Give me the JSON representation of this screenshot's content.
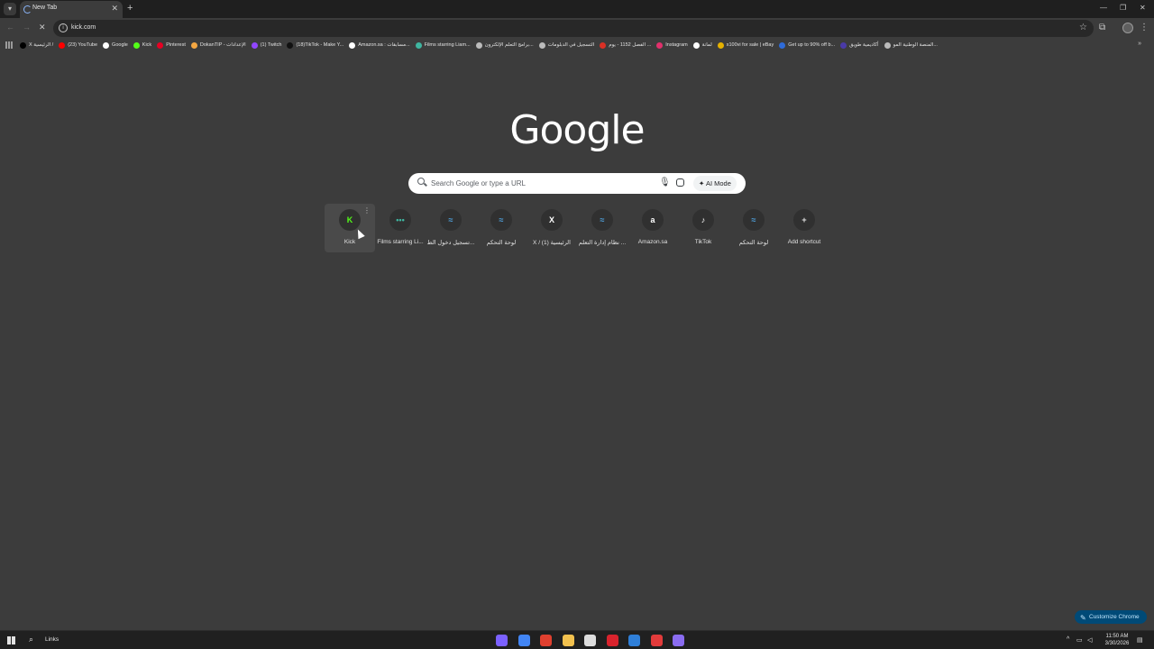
{
  "tab": {
    "title": "New Tab"
  },
  "omnibox": {
    "url": "kick.com"
  },
  "bookmarks": [
    {
      "label": "X الرئيسية /",
      "color": "#000000"
    },
    {
      "label": "(23) YouTube",
      "color": "#ff0000"
    },
    {
      "label": "Google",
      "color": "#ffffff"
    },
    {
      "label": "Kick",
      "color": "#53fc18"
    },
    {
      "label": "Pinterest",
      "color": "#e60023"
    },
    {
      "label": "DokanTIP - الإعدادات",
      "color": "#f4a742"
    },
    {
      "label": "(1) Twitch",
      "color": "#9146ff"
    },
    {
      "label": "(18)TikTok - Make Y...",
      "color": "#111111"
    },
    {
      "label": "Amazon.sa : مسابقات...",
      "color": "#ffffff"
    },
    {
      "label": "Films starring Liam...",
      "color": "#3fb5a0"
    },
    {
      "label": "برامج التعلم الإلكترون...",
      "color": "#bbbbbb"
    },
    {
      "label": "التسجيل في الدبلومات",
      "color": "#bbbbbb"
    },
    {
      "label": "الفصل 1152 - يوم ...",
      "color": "#d93025"
    },
    {
      "label": "Instagram",
      "color": "#e1306c"
    },
    {
      "label": "لمانة",
      "color": "#ffffff"
    },
    {
      "label": "x100vi for sale | eBay",
      "color": "#e5b100"
    },
    {
      "label": "Get up to 90% off b...",
      "color": "#2e6bd8"
    },
    {
      "label": "أكاديمية طويق",
      "color": "#4a3aa8"
    },
    {
      "label": "المنصة الوطنية المو...",
      "color": "#bbbbbb"
    }
  ],
  "logo": "Google",
  "search": {
    "placeholder": "Search Google or type a URL",
    "ai_mode": "AI Mode"
  },
  "shortcuts": [
    {
      "label": "Kick",
      "glyph": "K",
      "color": "#53fc18"
    },
    {
      "label": "Films starring Li...",
      "glyph": "•••",
      "color": "#3fb5a0"
    },
    {
      "label": "تسجيل دخول الط...",
      "glyph": "≈",
      "color": "#4fa3e0"
    },
    {
      "label": "لوحة التحكم",
      "glyph": "≈",
      "color": "#4fa3e0"
    },
    {
      "label": "X / (1) الرئيسية",
      "glyph": "X",
      "color": "#ffffff"
    },
    {
      "label": "نظام إدارة التعلم ...",
      "glyph": "≈",
      "color": "#4fa3e0"
    },
    {
      "label": "Amazon.sa",
      "glyph": "a",
      "color": "#ffffff"
    },
    {
      "label": "TikTok",
      "glyph": "♪",
      "color": "#ffffff"
    },
    {
      "label": "لوحة التحكم",
      "glyph": "≈",
      "color": "#4fa3e0"
    },
    {
      "label": "Add shortcut",
      "glyph": "+",
      "color": "#e3e3e3"
    }
  ],
  "customize": "Customize Chrome",
  "taskbar": {
    "search_label": "Links",
    "time": "11:50 AM",
    "date": "3/30/2026",
    "pinned_colors": [
      "#7b61ff",
      "#4285f4",
      "#e0402f",
      "#f2c14e",
      "#dddddd",
      "#d9232d",
      "#2f7fd8",
      "#e23b3b",
      "#8a6cf0"
    ]
  }
}
